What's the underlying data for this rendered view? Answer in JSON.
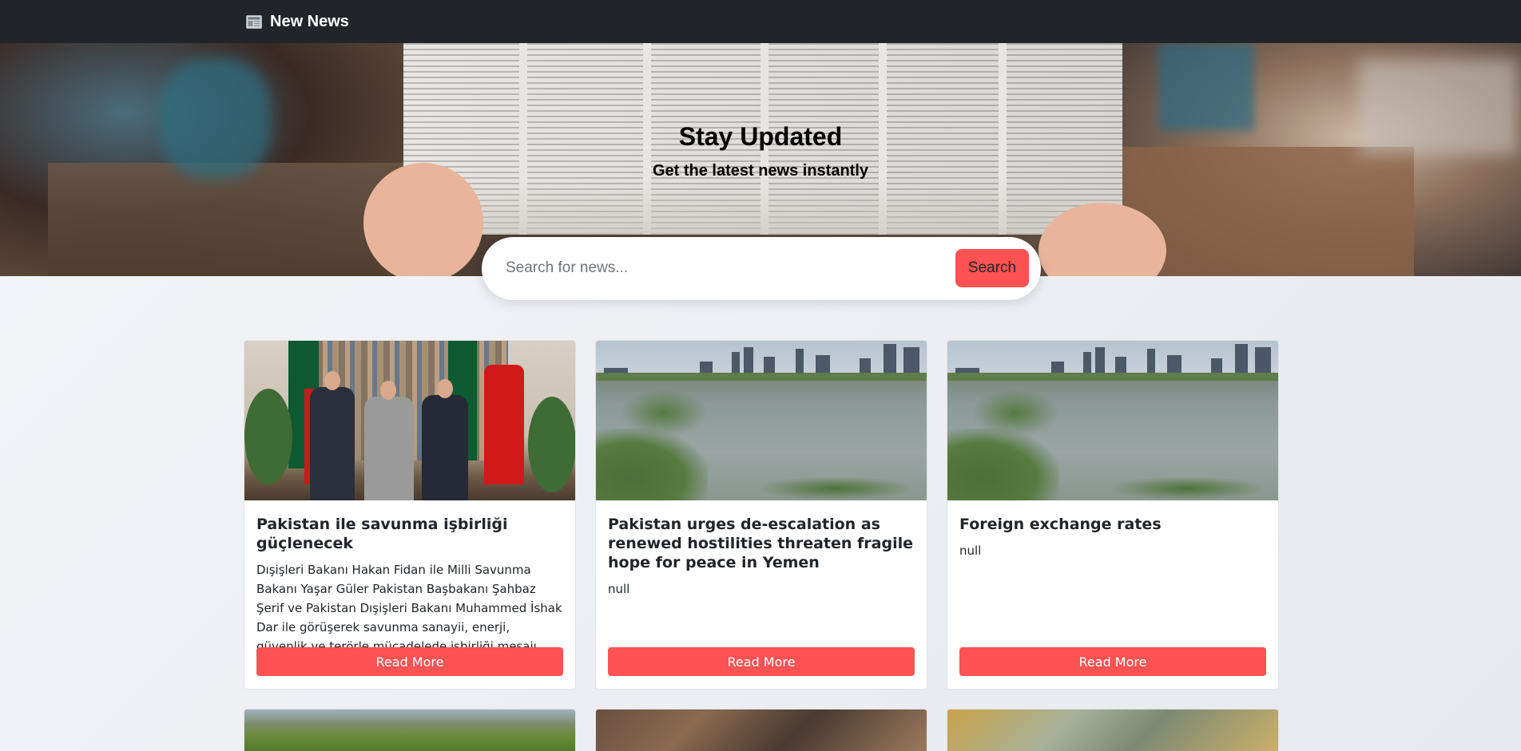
{
  "navbar": {
    "brand_icon": "newspaper-icon",
    "brand_label": "New News"
  },
  "hero": {
    "title": "Stay Updated",
    "subtitle": "Get the latest news instantly"
  },
  "search": {
    "placeholder": "Search for news...",
    "value": "",
    "button_label": "Search"
  },
  "colors": {
    "navbar_bg": "#212529",
    "accent": "#ff5252"
  },
  "cards": [
    {
      "title": "Pakistan ile savunma işbirliği güçlenecek",
      "description": "Dışişleri Bakanı Hakan Fidan ile Milli Savunma Bakanı Yaşar Güler Pakistan Başbakanı Şahbaz Şerif ve Pakistan Dışişleri Bakanı Muhammed İshak Dar ile görüşerek savunma sanayii, enerji, güvenlik ve terörle mücadelede işbirliği mesajı verdi.",
      "button_label": "Read More"
    },
    {
      "title": "Pakistan urges de-escalation as renewed hostilities threaten fragile hope for peace in Yemen",
      "description": "null",
      "button_label": "Read More"
    },
    {
      "title": "Foreign exchange rates",
      "description": "null",
      "button_label": "Read More"
    }
  ]
}
